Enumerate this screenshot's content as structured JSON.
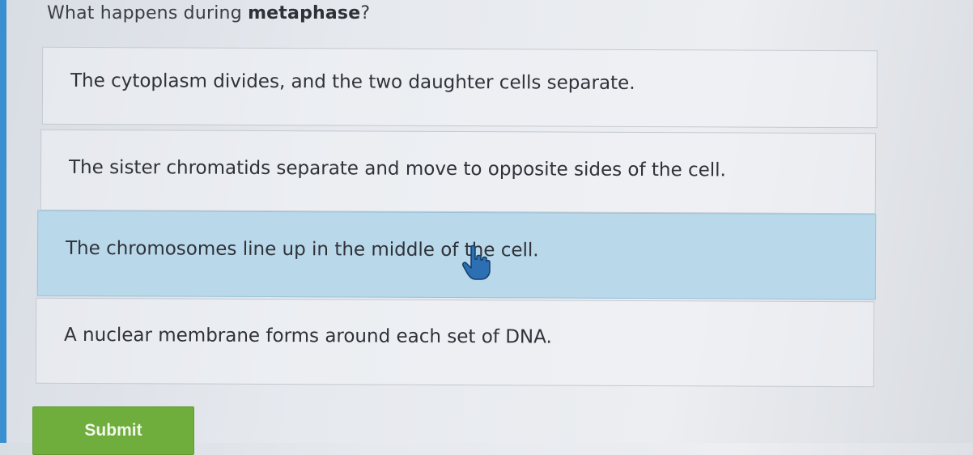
{
  "question": {
    "prefix": "What happens during ",
    "emphasis": "metaphase",
    "suffix": "?"
  },
  "options": [
    {
      "label": "The cytoplasm divides, and the two daughter cells separate.",
      "selected": false
    },
    {
      "label": "The sister chromatids separate and move to opposite sides of the cell.",
      "selected": false
    },
    {
      "label": "The chromosomes line up in the middle of the cell.",
      "selected": true
    },
    {
      "label": "A nuclear membrane forms around each set of DNA.",
      "selected": false
    }
  ],
  "submit": {
    "label": "Submit"
  },
  "cursor": {
    "icon": "hand-pointer-icon"
  },
  "colors": {
    "selected_background": "#b9d8ea",
    "submit_background": "#6fae3c",
    "accent_edge": "#3a8fd0"
  }
}
